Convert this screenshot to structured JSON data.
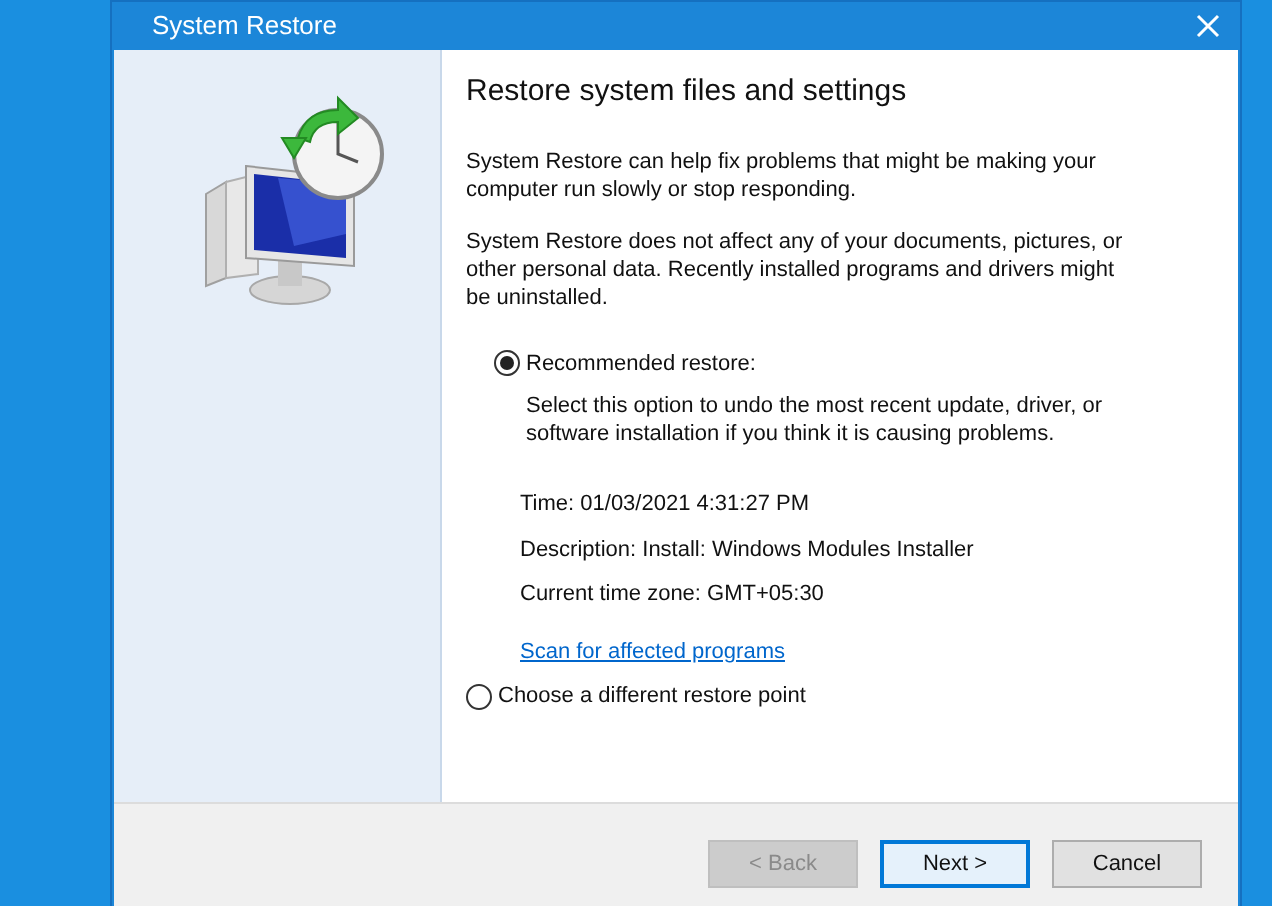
{
  "window": {
    "title": "System Restore"
  },
  "heading": "Restore system files and settings",
  "paragraphs": [
    "System Restore can help fix problems that might be making your computer run slowly or stop responding.",
    "System Restore does not affect any of your documents, pictures, or other personal data. Recently installed programs and drivers might be uninstalled."
  ],
  "options": [
    {
      "label": "Recommended restore:",
      "selected": true,
      "description": "Select this option to undo the most recent update, driver, or software installation if you think it is causing problems.",
      "details": [
        "Time: 01/03/2021 4:31:27 PM",
        "Description: Install: Windows Modules Installer",
        "Current time zone: GMT+05:30"
      ],
      "link": "Scan for affected programs"
    },
    {
      "label": "Choose a different restore point",
      "selected": false
    }
  ],
  "buttons": [
    {
      "label": "< Back",
      "disabled": true,
      "focused": false
    },
    {
      "label": "Next >",
      "disabled": false,
      "focused": true
    },
    {
      "label": "Cancel",
      "disabled": false,
      "focused": false
    }
  ]
}
